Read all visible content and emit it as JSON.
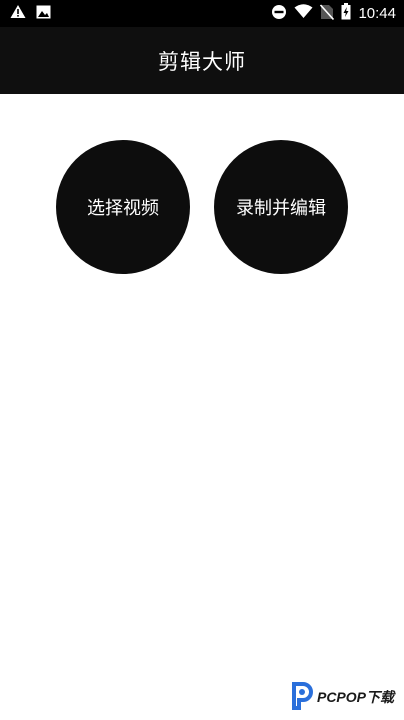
{
  "status_bar": {
    "time": "10:44",
    "icons_left": [
      "warning-icon",
      "image-icon"
    ],
    "icons_right": [
      "dnd-icon",
      "wifi-icon",
      "no-sim-icon",
      "battery-charging-icon"
    ]
  },
  "app_bar": {
    "title": "剪辑大师",
    "background": "#0f0f0f"
  },
  "actions": {
    "select_video": "选择视频",
    "record_edit": "录制并编辑"
  },
  "watermark": {
    "logo_text": "PCPOP下载",
    "icon": "pcpop-logo-icon"
  }
}
